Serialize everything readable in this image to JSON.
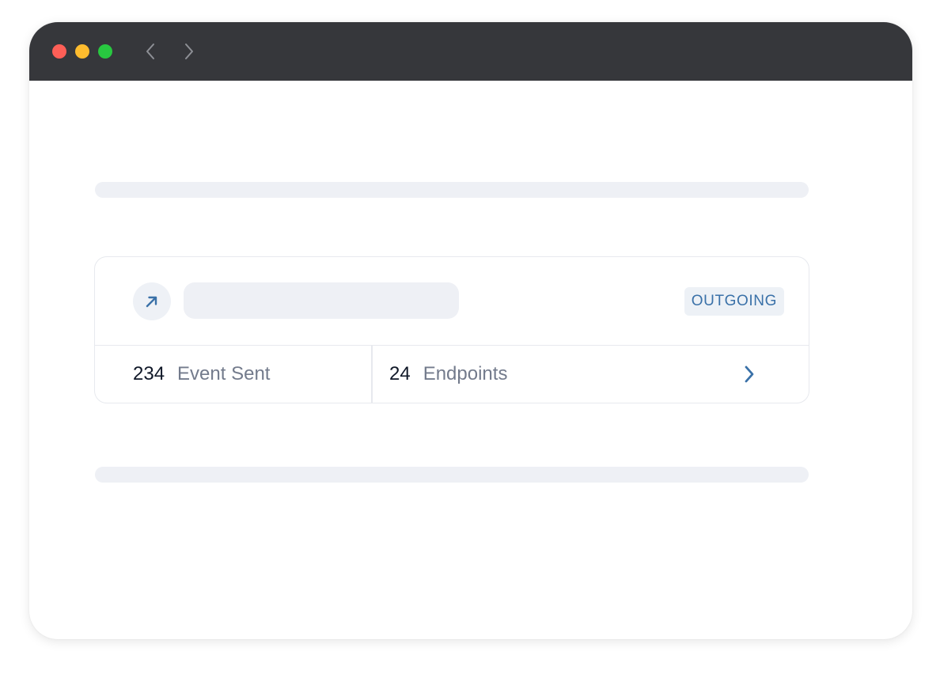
{
  "colors": {
    "titlebar": "#36373b",
    "close": "#fe5f57",
    "minimize": "#febc2e",
    "zoom": "#28c840",
    "accent": "#3a71a8",
    "skeleton": "#eef0f5",
    "border": "#e7e9ee"
  },
  "icons": {
    "back": "chevron-left-icon",
    "forward": "chevron-right-icon",
    "direction": "arrow-up-right-icon",
    "open": "chevron-right-icon"
  },
  "card": {
    "badge": "OUTGOING",
    "stats": [
      {
        "value": "234",
        "label": "Event Sent"
      },
      {
        "value": "24",
        "label": "Endpoints"
      }
    ]
  }
}
